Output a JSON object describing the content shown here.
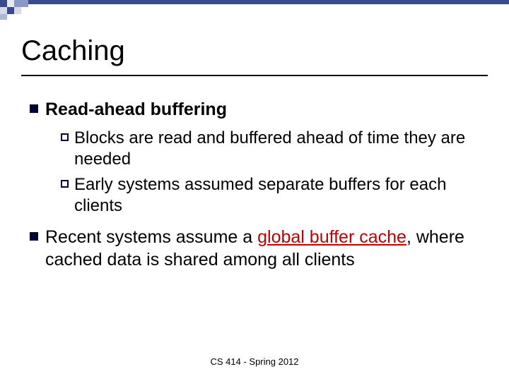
{
  "title": "Caching",
  "bullets": [
    {
      "heading": "Read-ahead buffering",
      "sub": [
        {
          "lead": "Blocks",
          "rest": " are read and buffered ahead of time they are needed"
        },
        {
          "lead": "Early",
          "rest": " systems assumed separate buffers for each clients"
        }
      ]
    },
    {
      "line_pre": "Recent systems assume a ",
      "line_em": "global buffer cache",
      "line_post": ", where cached data is shared among all clients"
    }
  ],
  "footer": "CS 414 - Spring 2012",
  "colors": {
    "accent": "#c00000",
    "bullet": "#000033"
  }
}
